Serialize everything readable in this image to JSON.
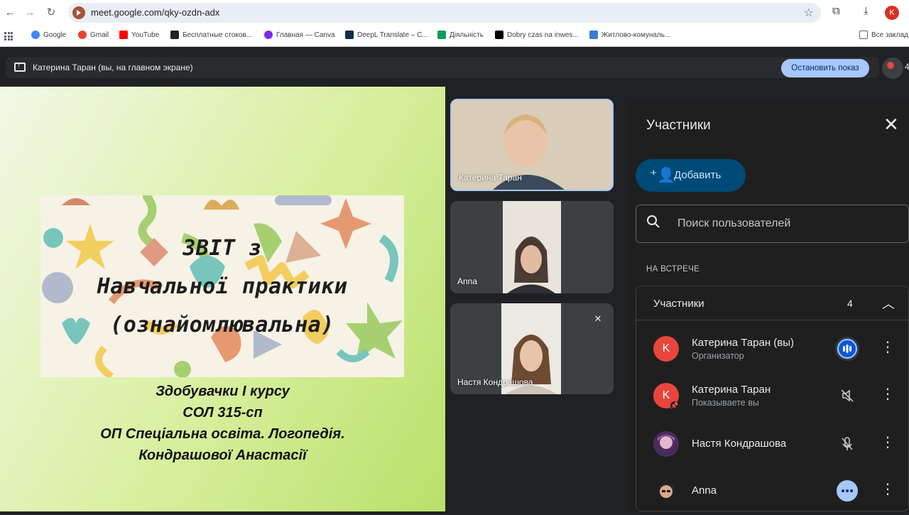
{
  "browser": {
    "url": "meet.google.com/qky-ozdn-adx",
    "profile_initial": "K",
    "bookmarks": [
      {
        "label": "Google",
        "color": "#4285f4"
      },
      {
        "label": "Gmail",
        "color": "#ea4335"
      },
      {
        "label": "YouTube",
        "color": "#ff0000"
      },
      {
        "label": "Бесплатные стоков...",
        "color": "#222222"
      },
      {
        "label": "Главная — Canva",
        "color": "#7d2ae8"
      },
      {
        "label": "DeepL Translate – С...",
        "color": "#0f2b46"
      },
      {
        "label": "Діяльність",
        "color": "#0f9d58"
      },
      {
        "label": "Dobry czas na inwes...",
        "color": "#000000"
      },
      {
        "label": "Житлово-комуналь...",
        "color": "#3a7bd5"
      }
    ],
    "all_bookmarks": "Все заклад"
  },
  "meet_bar": {
    "presenting_text": "Катерина Таран (вы, на главном экране)",
    "stop_button": "Остановить показ",
    "reactions_count": "4"
  },
  "slide": {
    "title_lines": [
      "ЗВІТ з",
      "Навчальної практики",
      "(ознайомлювальна)"
    ],
    "subtitle_lines": [
      "Здобувачки І курсу",
      "СОЛ 315-сп",
      "ОП Спеціальна освіта. Логопедія.",
      "Кондрашової Анастасії"
    ]
  },
  "tiles": [
    {
      "name": "Катерина Таран"
    },
    {
      "name": "Anna"
    },
    {
      "name": "Настя Кондрашова"
    }
  ],
  "panel": {
    "title": "Участники",
    "add_button": "Добавить",
    "search_placeholder": "Поиск пользователей",
    "section_label": "НА ВСТРЕЧЕ",
    "group_title": "Участники",
    "group_count": "4",
    "participants": [
      {
        "name": "Катерина Таран (вы)",
        "sub": "Организатор",
        "initial": "K",
        "status": "speaking"
      },
      {
        "name": "Катерина Таран",
        "sub": "Показываете вы",
        "initial": "K",
        "status": "muted"
      },
      {
        "name": "Настя Кондрашова",
        "sub": "",
        "initial": "",
        "status": "mic-muted"
      },
      {
        "name": "Anna",
        "sub": "",
        "initial": "",
        "status": "more"
      }
    ]
  },
  "colors": {
    "accent_blue": "#a8c7fa",
    "avatar_red": "#e8453c",
    "add_button_bg": "#004a77"
  }
}
